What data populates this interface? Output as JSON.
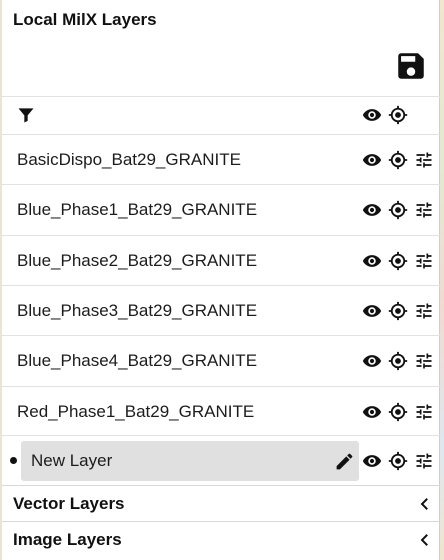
{
  "panel": {
    "title": "Local MilX Layers",
    "save_icon": "floppy-save-icon"
  },
  "filter_row": {
    "icons": [
      "filter-icon",
      "eye-icon",
      "locate-target-icon"
    ]
  },
  "layers": [
    {
      "label": "BasicDispo_Bat29_GRANITE"
    },
    {
      "label": "Blue_Phase1_Bat29_GRANITE"
    },
    {
      "label": "Blue_Phase2_Bat29_GRANITE"
    },
    {
      "label": "Blue_Phase3_Bat29_GRANITE"
    },
    {
      "label": "Blue_Phase4_Bat29_GRANITE"
    },
    {
      "label": "Red_Phase1_Bat29_GRANITE"
    }
  ],
  "active_layer": {
    "label": "New Layer",
    "active": true,
    "edit_icon": "pencil-icon"
  },
  "row_icons": [
    "eye-icon",
    "locate-target-icon",
    "tune-settings-icon"
  ],
  "sections": [
    {
      "label": "Vector Layers",
      "icon": "chevron-left-icon"
    },
    {
      "label": "Image Layers",
      "icon": "chevron-left-icon"
    }
  ],
  "colors": {
    "panel_bg": "#ffffff",
    "active_row_bg": "#e0e0e0",
    "icon_color": "#111111"
  }
}
